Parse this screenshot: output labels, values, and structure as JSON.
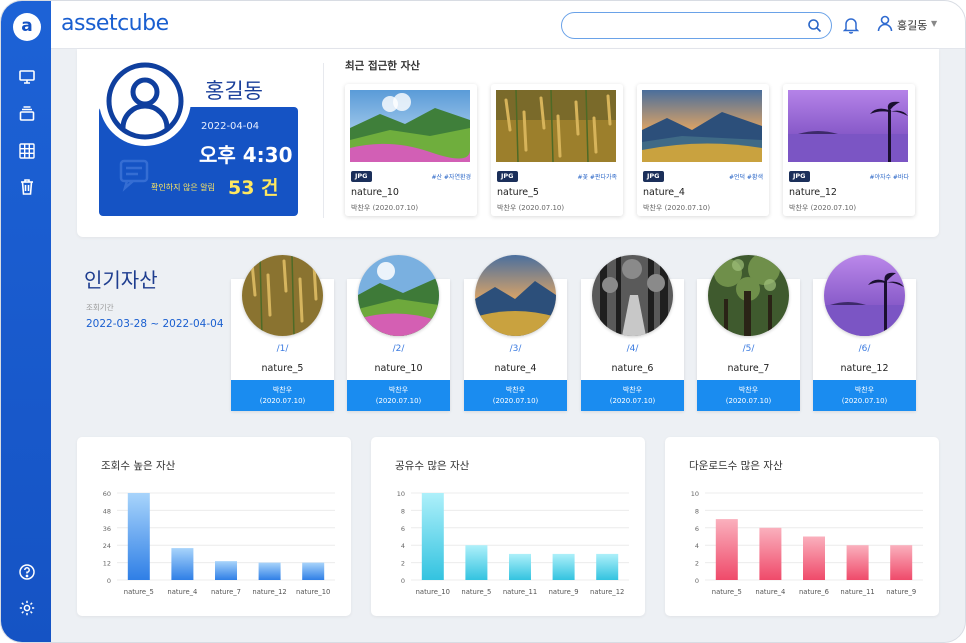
{
  "app": {
    "brand": "assetcube"
  },
  "header": {
    "search_placeholder": "",
    "user_name": "홍길동"
  },
  "sidebar": {
    "items": [
      "monitor-icon",
      "layers-icon",
      "grid-icon",
      "trash-icon",
      "help-icon",
      "settings-icon"
    ]
  },
  "profile": {
    "name": "홍길동",
    "date": "2022-04-04",
    "time": "오후 4:30",
    "unread_label": "확인하지 않은 알림",
    "unread_count": "53 건"
  },
  "recent": {
    "title": "최근 접근한 자산",
    "items": [
      {
        "name": "nature_10",
        "format": "JPG",
        "tags": "#산 #자연환경",
        "owner": "박찬우",
        "date": "(2020.07.10)"
      },
      {
        "name": "nature_5",
        "format": "JPG",
        "tags": "#꽃 #판다가족",
        "owner": "박찬우",
        "date": "(2020.07.10)"
      },
      {
        "name": "nature_4",
        "format": "JPG",
        "tags": "#언덕 #황색",
        "owner": "박찬우",
        "date": "(2020.07.10)"
      },
      {
        "name": "nature_12",
        "format": "JPG",
        "tags": "#야자수 #바다",
        "owner": "박찬우",
        "date": "(2020.07.10)"
      }
    ]
  },
  "popular": {
    "title": "인기자산",
    "period_label": "조회기간",
    "period": "2022-03-28 ~ 2022-04-04",
    "items": [
      {
        "rank": "/1/",
        "name": "nature_5",
        "owner": "박찬우",
        "date": "(2020.07.10)"
      },
      {
        "rank": "/2/",
        "name": "nature_10",
        "owner": "박찬우",
        "date": "(2020.07.10)"
      },
      {
        "rank": "/3/",
        "name": "nature_4",
        "owner": "박찬우",
        "date": "(2020.07.10)"
      },
      {
        "rank": "/4/",
        "name": "nature_6",
        "owner": "박찬우",
        "date": "(2020.07.10)"
      },
      {
        "rank": "/5/",
        "name": "nature_7",
        "owner": "박찬우",
        "date": "(2020.07.10)"
      },
      {
        "rank": "/6/",
        "name": "nature_12",
        "owner": "박찬우",
        "date": "(2020.07.10)"
      }
    ]
  },
  "chart_data": [
    {
      "type": "bar",
      "title": "조회수 높은 자산",
      "categories": [
        "nature_5",
        "nature_4",
        "nature_7",
        "nature_12",
        "nature_10"
      ],
      "values": [
        60,
        22,
        13,
        12,
        12
      ],
      "ylim": [
        0,
        60
      ],
      "yticks": [
        0,
        12,
        24,
        36,
        48,
        60
      ],
      "colors": [
        "#a8d4fb",
        "#2f7fe6"
      ],
      "grid": true
    },
    {
      "type": "bar",
      "title": "공유수 많은 자산",
      "categories": [
        "nature_10",
        "nature_5",
        "nature_11",
        "nature_9",
        "nature_12"
      ],
      "values": [
        10,
        4,
        3,
        3,
        3
      ],
      "ylim": [
        0,
        10
      ],
      "yticks": [
        0,
        2,
        4,
        6,
        8,
        10
      ],
      "colors": [
        "#aef0fa",
        "#33c3e0"
      ],
      "grid": true
    },
    {
      "type": "bar",
      "title": "다운로드수 많은 자산",
      "categories": [
        "nature_5",
        "nature_4",
        "nature_6",
        "nature_11",
        "nature_9"
      ],
      "values": [
        7,
        6,
        5,
        4,
        4
      ],
      "ylim": [
        0,
        10
      ],
      "yticks": [
        0,
        2,
        4,
        6,
        8,
        10
      ],
      "colors": [
        "#fab0bd",
        "#ef4a6a"
      ],
      "grid": true
    }
  ]
}
